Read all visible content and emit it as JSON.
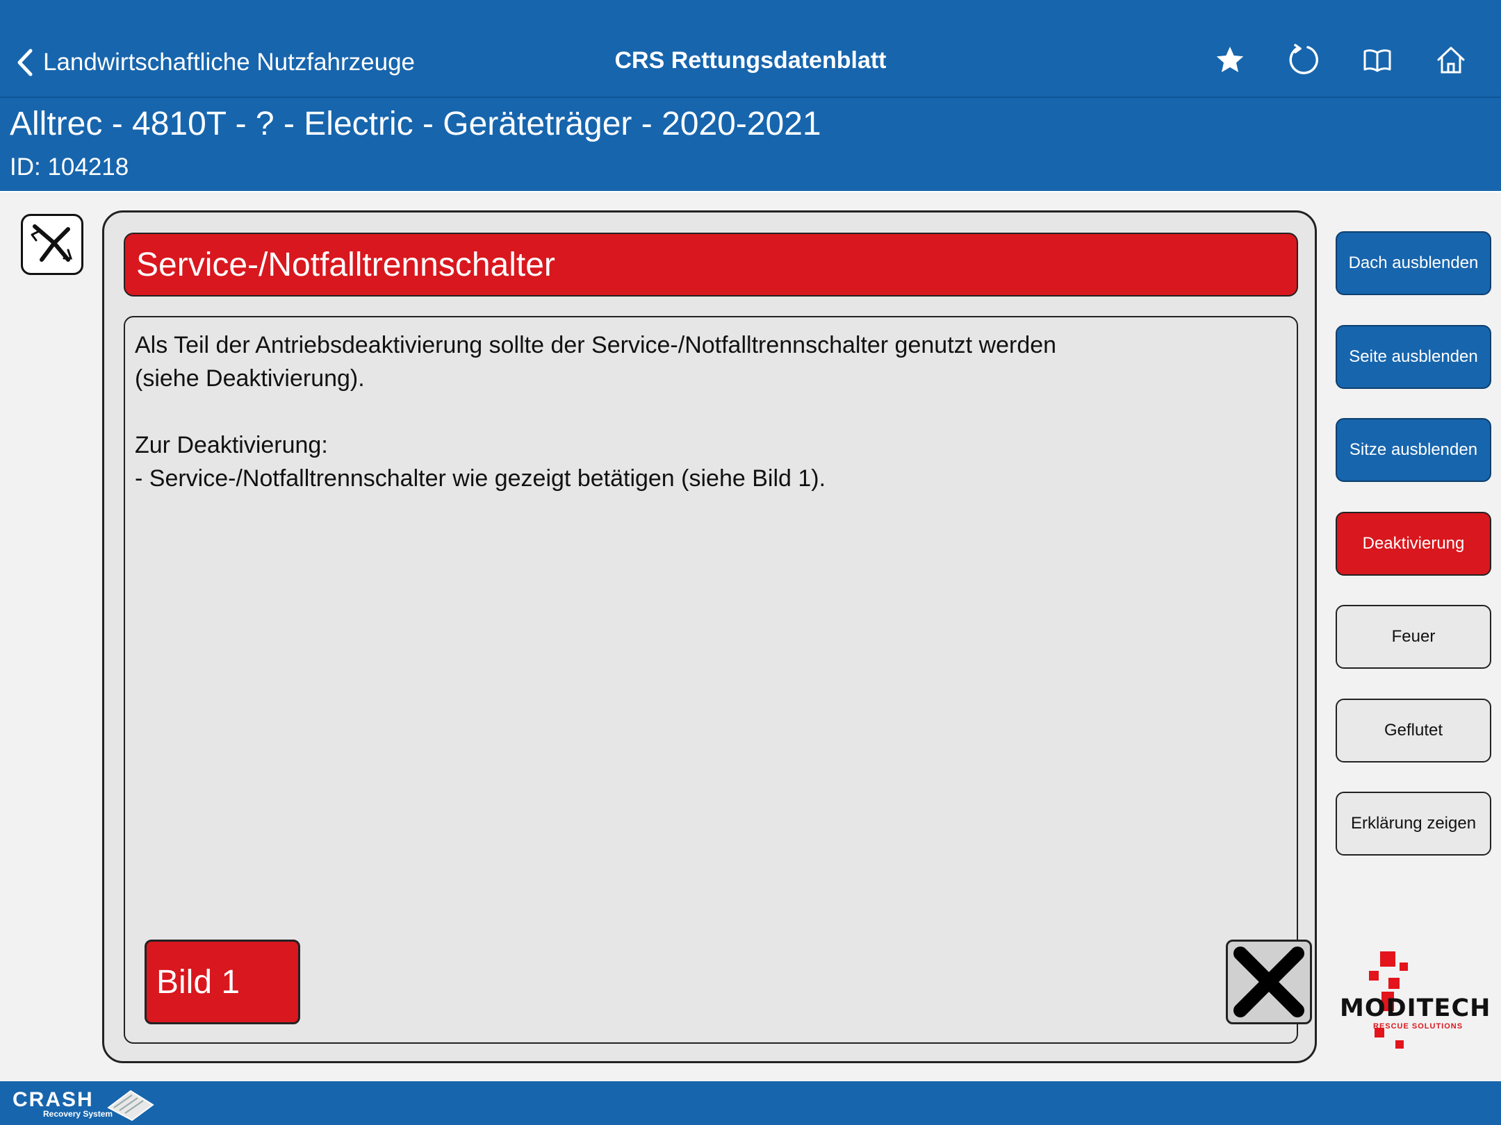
{
  "nav": {
    "back_label": "Landwirtschaftliche Nutzfahrzeuge",
    "title": "CRS Rettungsdatenblatt",
    "icons": [
      "star-icon",
      "refresh-icon",
      "book-icon",
      "home-icon"
    ]
  },
  "vehicle": {
    "title": "Alltrec - 4810T - ? - Electric - Geräteträger - 2020-2021",
    "id_line": "ID: 104218"
  },
  "panel": {
    "header": "Service-/Notfalltrennschalter",
    "paragraph1": "Als Teil der Antriebsdeaktivierung sollte der Service-/Notfalltrennschalter genutzt werden\n(siehe Deaktivierung).",
    "paragraph2": "Zur Deaktivierung:\n- Service-/Notfalltrennschalter wie gezeigt betätigen (siehe Bild 1).",
    "image_button": "Bild 1"
  },
  "side_buttons": {
    "roof": "Dach ausblenden",
    "side": "Seite ausblenden",
    "seats": "Sitze ausblenden",
    "deactivation": "Deaktivierung",
    "fire": "Feuer",
    "flooded": "Geflutet",
    "explanation": "Erklärung zeigen"
  },
  "logo": {
    "word": "MODITECH",
    "sub": "RESCUE SOLUTIONS"
  },
  "footer": {
    "brand": "CRASH",
    "sub": "Recovery System"
  },
  "colors": {
    "primary_blue": "#1765ad",
    "accent_red": "#d9171e",
    "panel_gray": "#e6e6e6"
  }
}
